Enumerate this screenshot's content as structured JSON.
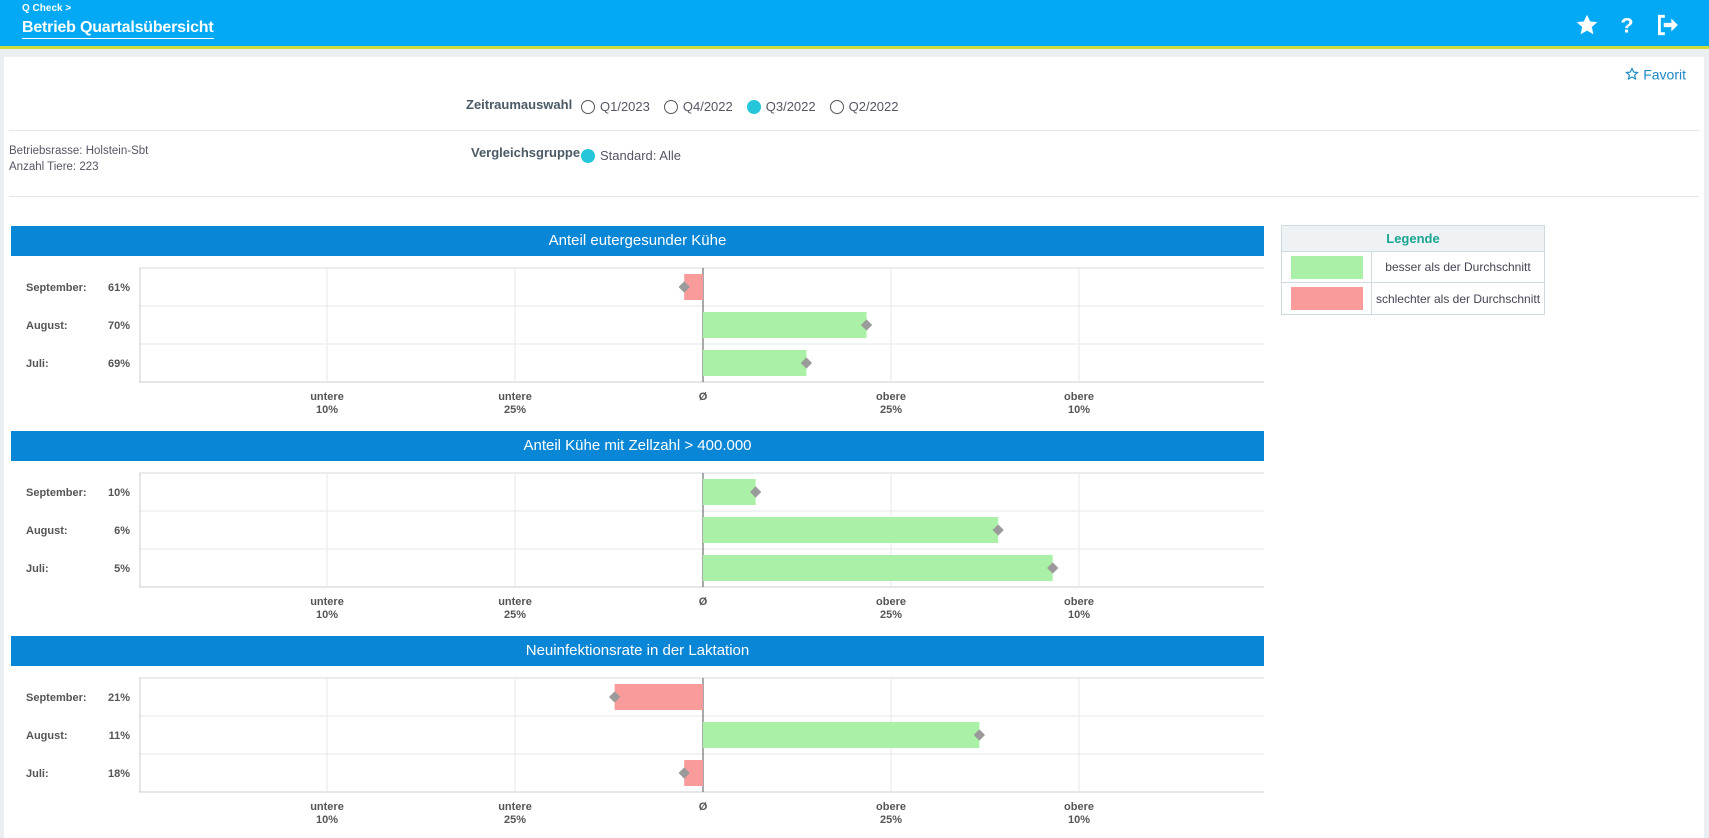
{
  "header": {
    "breadcrumb": "Q Check >",
    "title": "Betrieb Quartalsübersicht"
  },
  "icons": [
    "star-icon",
    "help-icon",
    "logout-icon"
  ],
  "favorite": {
    "label": "Favorit"
  },
  "period": {
    "label": "Zeitraumauswahl",
    "options": [
      {
        "label": "Q1/2023",
        "selected": false
      },
      {
        "label": "Q4/2022",
        "selected": false
      },
      {
        "label": "Q3/2022",
        "selected": true
      },
      {
        "label": "Q2/2022",
        "selected": false
      }
    ]
  },
  "comparison": {
    "label": "Vergleichsgruppe",
    "option": "Standard: Alle"
  },
  "farm": {
    "breed": "Betriebsrasse: Holstein-Sbt",
    "animals": "Anzahl Tiere: 223"
  },
  "colors": {
    "better": "#abf0a7",
    "worse": "#fa9b9b",
    "header": "#03a9f4",
    "chart_title": "#0a86d6"
  },
  "legend": {
    "title": "Legende",
    "items": [
      {
        "label": "besser als der Durchschnitt",
        "color": "#abf0a7"
      },
      {
        "label": "schlechter als der Durchschnitt",
        "color": "#fa9b9b"
      }
    ]
  },
  "chart_data": [
    {
      "type": "bar",
      "title": "Anteil eutergesunder Kühe",
      "x_ticks": [
        [
          "untere",
          "10%"
        ],
        [
          "untere",
          "25%"
        ],
        [
          "Ø",
          ""
        ],
        [
          "obere",
          "25%"
        ],
        [
          "obere",
          "10%"
        ]
      ],
      "rows": [
        {
          "month": "September:",
          "value": "61%",
          "score": -0.1,
          "status": "worse"
        },
        {
          "month": "August:",
          "value": "70%",
          "score": 0.87,
          "status": "better"
        },
        {
          "month": "Juli:",
          "value": "69%",
          "score": 0.55,
          "status": "better"
        }
      ]
    },
    {
      "type": "bar",
      "title": "Anteil Kühe mit Zellzahl > 400.000",
      "x_ticks": [
        [
          "untere",
          "10%"
        ],
        [
          "untere",
          "25%"
        ],
        [
          "Ø",
          ""
        ],
        [
          "obere",
          "25%"
        ],
        [
          "obere",
          "10%"
        ]
      ],
      "rows": [
        {
          "month": "September:",
          "value": "10%",
          "score": 0.28,
          "status": "better"
        },
        {
          "month": "August:",
          "value": "6%",
          "score": 1.57,
          "status": "better"
        },
        {
          "month": "Juli:",
          "value": "5%",
          "score": 1.86,
          "status": "better"
        }
      ]
    },
    {
      "type": "bar",
      "title": "Neuinfektionsrate in der Laktation",
      "x_ticks": [
        [
          "untere",
          "10%"
        ],
        [
          "untere",
          "25%"
        ],
        [
          "Ø",
          ""
        ],
        [
          "obere",
          "25%"
        ],
        [
          "obere",
          "10%"
        ]
      ],
      "rows": [
        {
          "month": "September:",
          "value": "21%",
          "score": -0.47,
          "status": "worse"
        },
        {
          "month": "August:",
          "value": "11%",
          "score": 1.47,
          "status": "better"
        },
        {
          "month": "Juli:",
          "value": "18%",
          "score": -0.1,
          "status": "worse"
        }
      ]
    }
  ]
}
